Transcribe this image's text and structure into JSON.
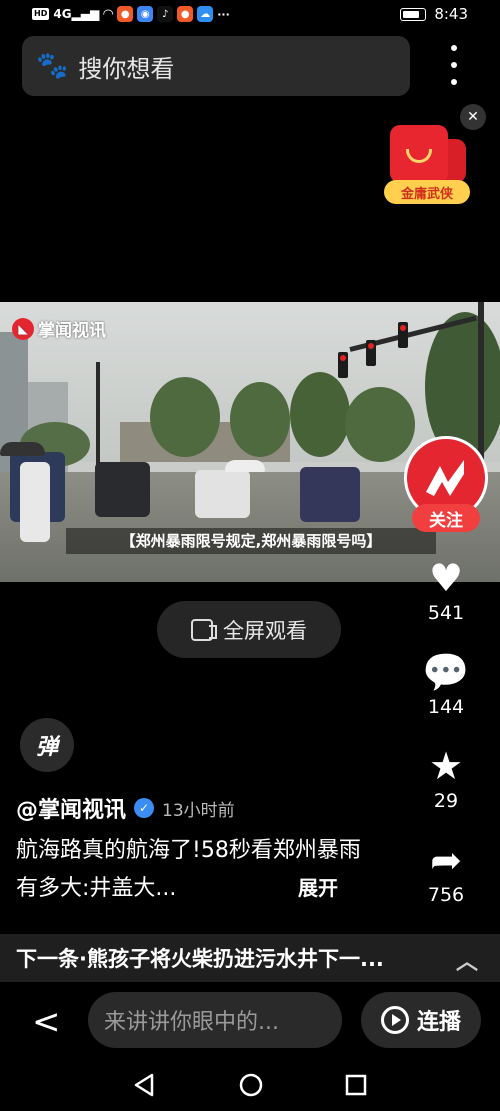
{
  "status_bar": {
    "network": "HD",
    "signal_label": "4G",
    "time": "8:43",
    "more": "···"
  },
  "search": {
    "placeholder": "搜你想看"
  },
  "promo": {
    "label": "金庸武侠"
  },
  "video": {
    "watermark": "掌闻视讯",
    "caption": "【郑州暴雨限号规定,郑州暴雨限号吗】"
  },
  "fullscreen_label": "全屏观看",
  "follow_label": "关注",
  "actions": {
    "likes": "541",
    "comments": "144",
    "favorites": "29",
    "shares": "756"
  },
  "danmaku_label": "弹",
  "author": {
    "name": "@掌闻视讯",
    "time": "13小时前"
  },
  "description": "航海路真的航海了!58秒看郑州暴雨有多大:井盖大...",
  "expand_label": "展开",
  "next": {
    "text": "下一条·熊孩子将火柴扔进污水井下一..."
  },
  "bottom_bar": {
    "comment_placeholder": "来讲讲你眼中的...",
    "autoplay_label": "连播"
  }
}
